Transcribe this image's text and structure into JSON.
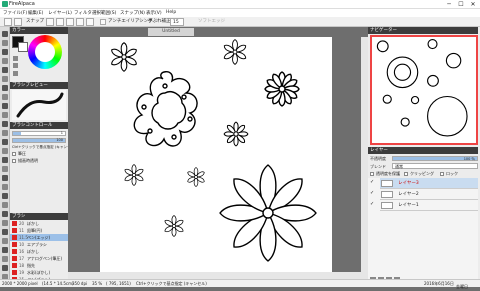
{
  "app": {
    "title": "FireAlpaca"
  },
  "window": {
    "minimize": "─",
    "maximize": "☐",
    "close": "✕"
  },
  "menu": [
    "ファイル(F)",
    "編集(E)",
    "レイヤー(L)",
    "フィルタ",
    "選択範囲(S)",
    "スナップ(N)",
    "表示(V)",
    "Help"
  ],
  "toolbar": {
    "snap_label": "スナップ",
    "antialias_label": "アンチエイリアシング",
    "correction_label": "手ぶれ補正",
    "correction_value": "15",
    "softedge_label": "ソフトエッジ"
  },
  "colors": {
    "accent": "#e02020",
    "panel_header": "#3c3c3c",
    "canvas_bg": "#6e6e6e",
    "selected_layer": "#c9dcf0"
  },
  "color_panel": {
    "title": "カラー"
  },
  "brush_preview": {
    "title": "ブラシプレビュー"
  },
  "brush_control": {
    "title": "ブラシコントロール",
    "size_value": "1",
    "opacity_value": "100",
    "hint": "Ctrl+クリックで基点指定 (キャンセル)",
    "opt1": "筆圧",
    "opt2": "描画時透明"
  },
  "brush_panel": {
    "title": "ブラシ",
    "items": [
      {
        "num": "20",
        "name": "ぼかし"
      },
      {
        "num": "11",
        "name": "鉛筆(円)"
      },
      {
        "num": "11.5",
        "name": "ペン(エッジ)"
      },
      {
        "num": "10",
        "name": "エアブラシ"
      },
      {
        "num": "16",
        "name": "ぼかし"
      },
      {
        "num": "17",
        "name": "アナログペン(筆圧)"
      },
      {
        "num": "18",
        "name": "指先"
      },
      {
        "num": "19",
        "name": "水彩(ぼかし)"
      },
      {
        "num": "15",
        "name": "ペン(ブラシ)"
      }
    ]
  },
  "document": {
    "title": "Untitled"
  },
  "navigator": {
    "title": "ナビゲーター"
  },
  "layer_panel": {
    "title": "レイヤー",
    "opacity_label": "不透明度",
    "opacity_value": "100 ％",
    "blend_label": "ブレンド",
    "blend_value": "通常",
    "clipping_label": "クリッピング",
    "protect_label": "透明度を保護",
    "lock_label": "ロック",
    "layers": [
      {
        "name": "レイヤー3",
        "selected": true
      },
      {
        "name": "レイヤー2",
        "selected": false
      },
      {
        "name": "レイヤー1",
        "selected": false
      }
    ]
  },
  "status": {
    "size": "2000 * 2000 pixel",
    "cm": "(14.5 * 14.5cm)",
    "dpi": "350 dpi",
    "zoom": "35 %",
    "coords": "(  795,  1651)",
    "hint": "Ctrl+クリックで基点指定 (キャンセル)",
    "datetime": "2016年6月16日",
    "day": "金曜日"
  }
}
